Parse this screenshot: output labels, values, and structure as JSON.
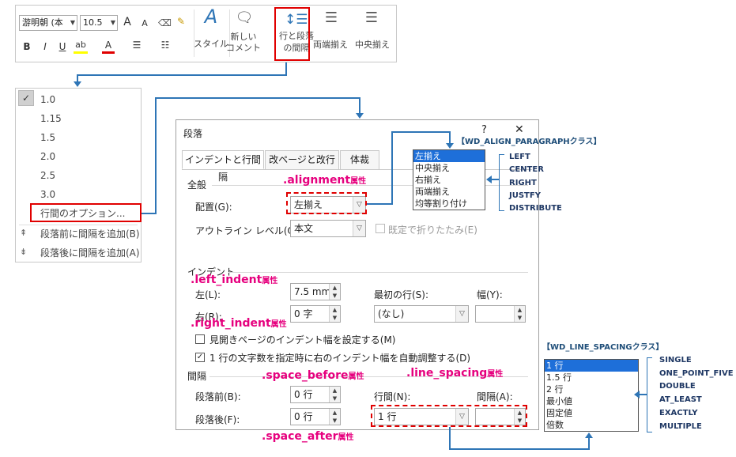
{
  "ribbon": {
    "font_name": "游明朝 (本",
    "font_size": "10.5",
    "grow_font": "A",
    "shrink_font": "A",
    "bold": "B",
    "italic": "I",
    "underline": "U",
    "style_label": "スタイル",
    "new_comment_label": "新しい\nコメント",
    "spacing_label": "行と段落\nの間隔",
    "justify_label": "両端揃え",
    "center_label": "中央揃え"
  },
  "menu": {
    "items": [
      "1.0",
      "1.15",
      "1.5",
      "2.0",
      "2.5",
      "3.0"
    ],
    "options": "行間のオプション...",
    "add_before": "段落前に間隔を追加(B)",
    "add_after": "段落後に間隔を追加(A)"
  },
  "dialog": {
    "title": "段落",
    "help": "?",
    "close": "✕",
    "tabs": [
      "インデントと行間隔",
      "改ページと改行",
      "体裁"
    ],
    "general": "全般",
    "alignment_label": "配置(G):",
    "alignment_value": "左揃え",
    "outline_label": "アウトライン レベル(O):",
    "outline_value": "本文",
    "collapse_label": "既定で折りたたみ(E)",
    "indent": "インデント",
    "left_label": "左(L):",
    "left_value": "7.5 mm",
    "right_label": "右(R):",
    "right_value": "0 字",
    "first_line_label": "最初の行(S):",
    "first_line_value": "(なし)",
    "width_label": "幅(Y):",
    "mirror_label": "見開きページのインデント幅を設定する(M)",
    "auto_adjust_label": "1 行の文字数を指定時に右のインデント幅を自動調整する(D)",
    "spacing": "間隔",
    "before_label": "段落前(B):",
    "before_value": "0 行",
    "after_label": "段落後(F):",
    "after_value": "0 行",
    "line_spacing_label": "行間(N):",
    "line_spacing_value": "1 行",
    "at_label": "間隔(A):"
  },
  "align_list": [
    "左揃え",
    "中央揃え",
    "右揃え",
    "両端揃え",
    "均等割り付け"
  ],
  "align_enum": {
    "title": "【WD_ALIGN_PARAGRAPHクラス】",
    "items": [
      "LEFT",
      "CENTER",
      "RIGHT",
      "JUSTFY",
      "DISTRIBUTE"
    ]
  },
  "spacing_list": [
    "1 行",
    "1.5 行",
    "2 行",
    "最小値",
    "固定値",
    "倍数"
  ],
  "spacing_enum": {
    "title": "【WD_LINE_SPACINGクラス】",
    "items": [
      "SINGLE",
      "ONE_POINT_FIVE",
      "DOUBLE",
      "AT_LEAST",
      "EXACTLY",
      "MULTIPLE"
    ]
  },
  "annotations": {
    "alignment": ".alignment",
    "left_indent": ".left_indent",
    "right_indent": ".right_indent",
    "space_before": ".space_before",
    "line_spacing": ".line_spacing",
    "space_after": ".space_after",
    "attr": "属性"
  }
}
